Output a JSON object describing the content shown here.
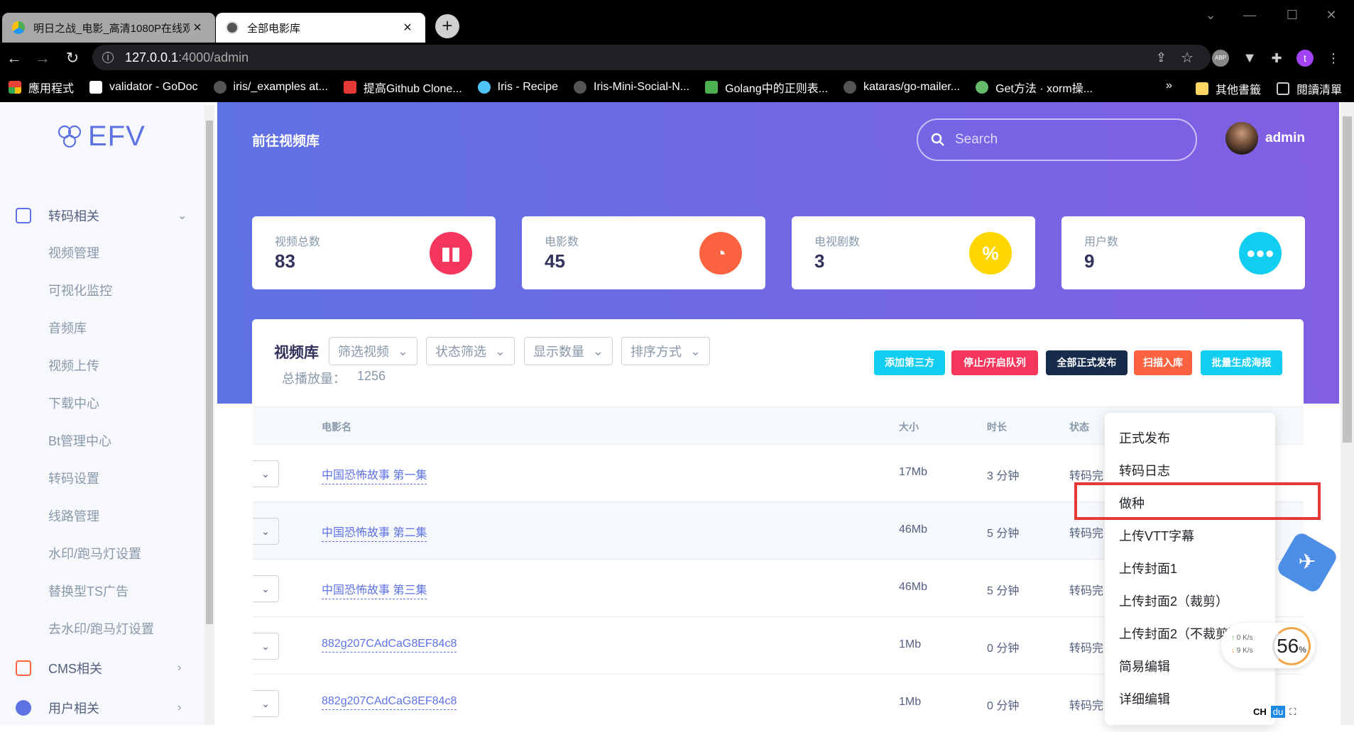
{
  "browser": {
    "tabs": [
      {
        "title": "明日之战_电影_高清1080P在线观",
        "active": false
      },
      {
        "title": "全部电影库",
        "active": true
      }
    ],
    "url_host": "127.0.0.1",
    "url_path": ":4000/admin",
    "bookmarks": [
      "應用程式",
      "validator - GoDoc",
      "iris/_examples at...",
      "提高Github Clone...",
      "Iris - Recipe",
      "Iris-Mini-Social-N...",
      "Golang中的正则表...",
      "kataras/go-mailer...",
      "Get方法 · xorm操..."
    ],
    "bookmarks_overflow": "»",
    "other_bookmarks": "其他書籤",
    "reading_list": "閱讀清單",
    "profile_letter": "t",
    "abp": "ABP"
  },
  "sidebar": {
    "logo": "EFV",
    "sections": [
      {
        "label": "转码相关",
        "expanded": true
      },
      {
        "label": "CMS相关"
      },
      {
        "label": "用户相关"
      }
    ],
    "items": [
      "视频管理",
      "可视化监控",
      "音频库",
      "视频上传",
      "下载中心",
      "Bt管理中心",
      "转码设置",
      "线路管理",
      "水印/跑马灯设置",
      "替换型TS广告",
      "去水印/跑马灯设置"
    ]
  },
  "header": {
    "brand": "前往视频库",
    "search_placeholder": "Search",
    "username": "admin"
  },
  "stats": [
    {
      "label": "视频总数",
      "value": "83",
      "color": "#f5365c",
      "icon": "chart-bar-icon"
    },
    {
      "label": "电影数",
      "value": "45",
      "color": "#fb6340",
      "icon": "chart-pie-icon"
    },
    {
      "label": "电视剧数",
      "value": "3",
      "color": "#ffd600",
      "icon": "percent-icon"
    },
    {
      "label": "用户数",
      "value": "9",
      "color": "#11cdef",
      "icon": "users-icon"
    }
  ],
  "library": {
    "title": "视频库",
    "filters": [
      "筛选视频",
      "状态筛选",
      "显示数量",
      "排序方式"
    ],
    "plays_label": "总播放量：",
    "plays_value": "1256",
    "buttons": [
      {
        "label": "添加第三方",
        "color": "#11cdef"
      },
      {
        "label": "停止/开启队列",
        "color": "#f5365c"
      },
      {
        "label": "全部正式发布",
        "color": "#172b4d"
      },
      {
        "label": "扫描入库",
        "color": "#fb6340"
      },
      {
        "label": "批量生成海报",
        "color": "#11cdef"
      }
    ],
    "columns": [
      "电影名",
      "大小",
      "时长",
      "状态"
    ],
    "rows": [
      {
        "name": "中国恐怖故事 第一集",
        "size": "17Mb",
        "duration": "3 分钟",
        "status": "转码完"
      },
      {
        "name": "中国恐怖故事 第二集",
        "size": "46Mb",
        "duration": "5 分钟",
        "status": "转码完"
      },
      {
        "name": "中国恐怖故事 第三集",
        "size": "46Mb",
        "duration": "5 分钟",
        "status": "转码完"
      },
      {
        "name": "882g207CAdCaG8EF84c8",
        "size": "1Mb",
        "duration": "0 分钟",
        "status": "转码完"
      },
      {
        "name": "882g207CAdCaG8EF84c8",
        "size": "1Mb",
        "duration": "0 分钟",
        "status": "转码完"
      }
    ]
  },
  "context_menu": {
    "items": [
      "正式发布",
      "转码日志",
      "做种",
      "上传VTT字幕",
      "上传封面1",
      "上传封面2（裁剪）",
      "上传封面2（不裁剪）",
      "简易编辑",
      "详细编辑"
    ],
    "highlighted": "做种",
    "highlight_color": "#e53935"
  },
  "widgets": {
    "net_up": "0",
    "net_down": "9",
    "net_unit": "K/s",
    "percent": "56",
    "percent_sign": "%",
    "ime": "CH",
    "ime2": "du"
  }
}
